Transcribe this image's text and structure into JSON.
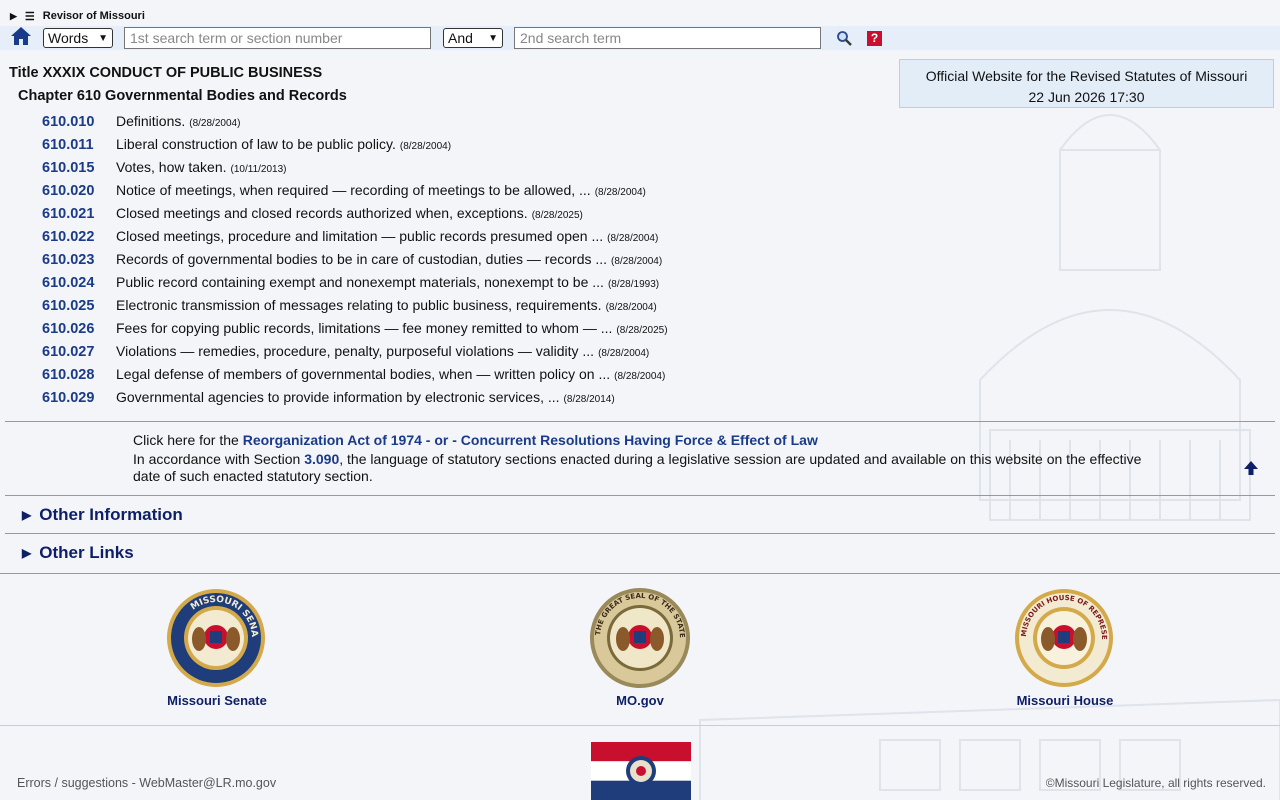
{
  "header": {
    "site_name": "Revisor of Missouri",
    "search": {
      "mode_selected": "Words",
      "term1_placeholder": "1st search term or section number",
      "connector_selected": "And",
      "term2_placeholder": "2nd search term"
    },
    "help_label": "?"
  },
  "official": {
    "text": "Official Website for the Revised Statutes of Missouri",
    "datetime": "22 Jun 2026 17:30"
  },
  "title": "Title XXXIX CONDUCT OF PUBLIC BUSINESS",
  "chapter": "Chapter 610 Governmental Bodies and Records",
  "sections": [
    {
      "num": "610.010",
      "text": "Definitions.",
      "date": "(8/28/2004)"
    },
    {
      "num": "610.011",
      "text": "Liberal construction of law to be public policy.",
      "date": "(8/28/2004)"
    },
    {
      "num": "610.015",
      "text": "Votes, how taken.",
      "date": "(10/11/2013)"
    },
    {
      "num": "610.020",
      "text": "Notice of meetings, when required — recording of meetings to be allowed, ...",
      "date": "(8/28/2004)"
    },
    {
      "num": "610.021",
      "text": "Closed meetings and closed records authorized when, exceptions.",
      "date": "(8/28/2025)"
    },
    {
      "num": "610.022",
      "text": "Closed meetings, procedure and limitation — public records presumed open ...",
      "date": "(8/28/2004)"
    },
    {
      "num": "610.023",
      "text": "Records of governmental bodies to be in care of custodian, duties — records ...",
      "date": "(8/28/2004)"
    },
    {
      "num": "610.024",
      "text": "Public record containing exempt and nonexempt materials, nonexempt to be ...",
      "date": "(8/28/1993)"
    },
    {
      "num": "610.025",
      "text": "Electronic transmission of messages relating to public business, requirements.",
      "date": "(8/28/2004)"
    },
    {
      "num": "610.026",
      "text": "Fees for copying public records, limitations — fee money remitted to whom — ...",
      "date": "(8/28/2025)"
    },
    {
      "num": "610.027",
      "text": "Violations — remedies, procedure, penalty, purposeful violations — validity ...",
      "date": "(8/28/2004)"
    },
    {
      "num": "610.028",
      "text": "Legal defense of members of governmental bodies, when — written policy on ...",
      "date": "(8/28/2004)"
    },
    {
      "num": "610.029",
      "text": "Governmental agencies to provide information by electronic services, ...",
      "date": "(8/28/2014)"
    }
  ],
  "reorg": {
    "prefix": "Click here for the",
    "link1": "Reorganization Act of 1974",
    "sep": "- or -",
    "link2": "Concurrent Resolutions Having Force & Effect of Law",
    "line2_prefix": "In accordance with Section",
    "section_link": "3.090",
    "line2_suffix": ", the language of statutory sections enacted during a legislative session are updated and available on this website on the effective date of such enacted statutory section."
  },
  "disclosures": [
    "Other Information",
    "Other Links"
  ],
  "seals": [
    {
      "label": "Missouri Senate",
      "ring_text": "MISSOURI SENATE"
    },
    {
      "label": "MO.gov",
      "ring_text": "THE GREAT SEAL OF THE STATE OF MISSOURI"
    },
    {
      "label": "Missouri House",
      "ring_text": "MISSOURI HOUSE OF REPRESENTATIVES"
    }
  ],
  "footer": {
    "errors": "Errors / suggestions - WebMaster@LR.mo.gov",
    "copyright": "©Missouri Legislature, all rights reserved."
  },
  "colors": {
    "link": "#1a3a8a",
    "accent_bar": "#e6eef9",
    "help_red": "#c8102e"
  }
}
